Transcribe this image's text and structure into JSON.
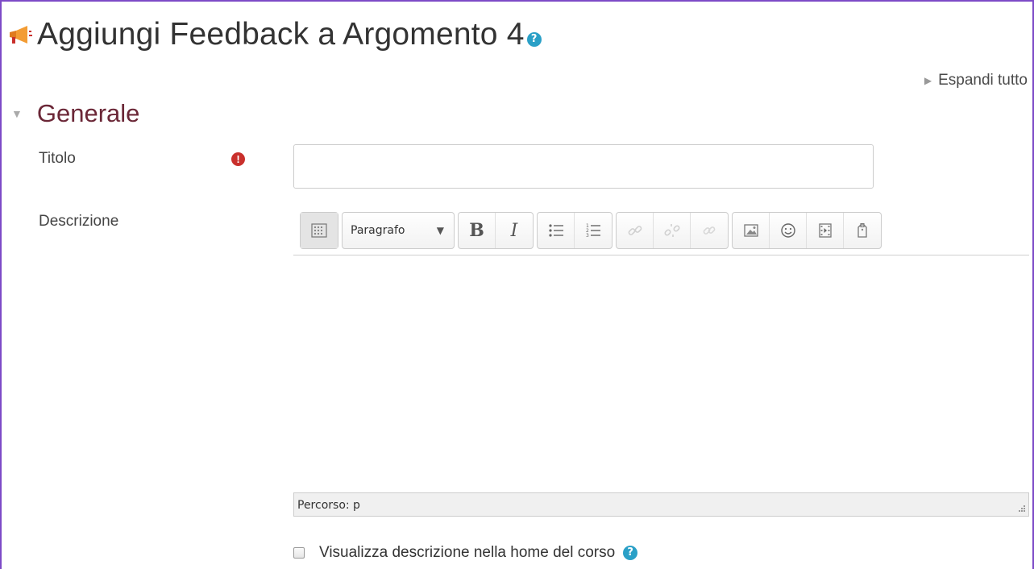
{
  "page": {
    "title": "Aggiungi Feedback a Argomento 4",
    "help_icon": "help-icon"
  },
  "expand_all": "Espandi tutto",
  "section": {
    "title": "Generale"
  },
  "fields": {
    "title_label": "Titolo",
    "title_value": "",
    "required_icon": "exclamation-circle-icon",
    "description_label": "Descrizione"
  },
  "editor": {
    "paragraph_select": "Paragrafo",
    "toolbar_icons": [
      "toolbar-toggle-icon",
      "bold-icon",
      "italic-icon",
      "unordered-list-icon",
      "ordered-list-icon",
      "link-icon",
      "unlink-icon",
      "auto-link-icon",
      "image-icon",
      "emoticon-icon",
      "media-icon",
      "manage-files-icon"
    ],
    "bold_label": "B",
    "italic_label": "I",
    "content": "",
    "path": "Percorso: p"
  },
  "show_description": {
    "label": "Visualizza descrizione nella home del corso",
    "checked": false
  },
  "colors": {
    "accent_border": "#7d4ac7",
    "section_title": "#6b2737",
    "required": "#c9302c",
    "help": "#2aa0c7"
  }
}
